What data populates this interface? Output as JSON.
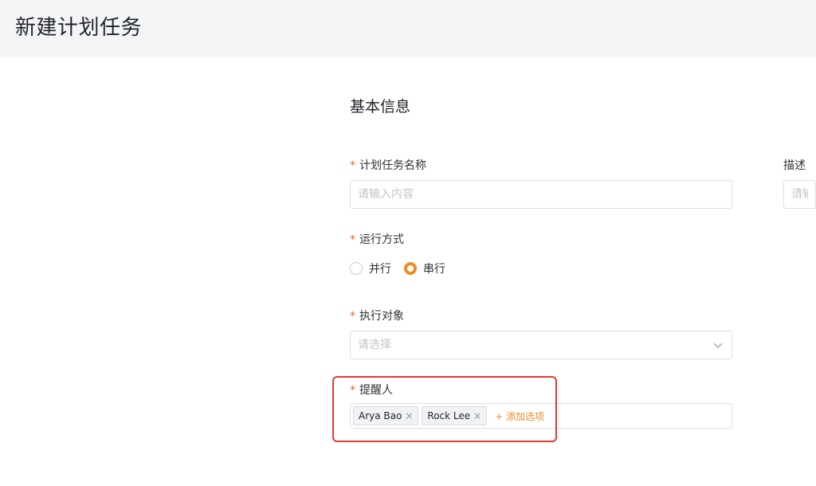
{
  "header": {
    "title": "新建计划任务"
  },
  "section": {
    "title": "基本信息"
  },
  "fields": {
    "required_mark": "*",
    "task_name": {
      "label": "计划任务名称",
      "placeholder": "请输入内容",
      "value": ""
    },
    "description": {
      "label": "描述",
      "placeholder": "请输入内容",
      "value": ""
    },
    "run_mode": {
      "label": "运行方式",
      "options": [
        {
          "label": "并行",
          "checked": false
        },
        {
          "label": "串行",
          "checked": true
        }
      ]
    },
    "target": {
      "label": "执行对象",
      "placeholder": "请选择"
    },
    "reminder": {
      "label": "提醒人",
      "tags": [
        "Arya Bao",
        "Rock Lee"
      ],
      "tag_close": "×",
      "add_label": "+ 添加选项"
    }
  },
  "colors": {
    "accent": "#f08a24",
    "required": "#f0641e",
    "highlight": "#e8392c",
    "header_bg": "#f4f5f7"
  },
  "icons": {
    "select_arrow": "chevron-down-icon",
    "tag_remove": "close-icon"
  }
}
